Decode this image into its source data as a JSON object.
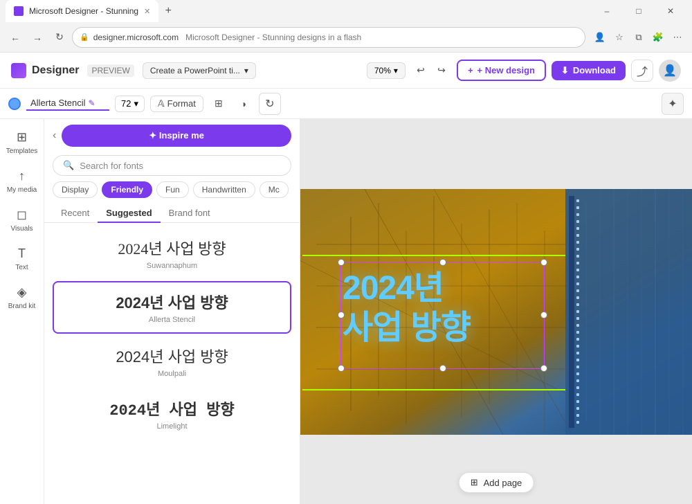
{
  "browser": {
    "tab_title": "Microsoft Designer - Stunning",
    "favicon_color": "#7c3aed",
    "url_domain": "designer.microsoft.com",
    "url_title": "Microsoft Designer - Stunning designs in a flash",
    "window_controls": [
      "minimize",
      "maximize",
      "close"
    ]
  },
  "app_header": {
    "logo_text": "Designer",
    "preview_label": "PREVIEW",
    "breadcrumb": "Create a PowerPoint ti...",
    "zoom": "70%",
    "new_design_label": "+ New design",
    "download_label": "Download"
  },
  "font_toolbar": {
    "font_name": "Allerta Stencil",
    "font_size": "72",
    "format_label": "Format"
  },
  "font_panel": {
    "inspire_label": "✦ Inspire me",
    "search_placeholder": "Search for fonts",
    "filters": [
      {
        "label": "Display",
        "active": false
      },
      {
        "label": "Friendly",
        "active": true
      },
      {
        "label": "Fun",
        "active": false
      },
      {
        "label": "Handwritten",
        "active": false
      },
      {
        "label": "Mc",
        "active": false
      }
    ],
    "tabs": [
      {
        "label": "Recent",
        "active": false
      },
      {
        "label": "Suggested",
        "active": true
      },
      {
        "label": "Brand font",
        "active": false
      }
    ],
    "fonts": [
      {
        "preview": "2024년 사업 방향",
        "name": "Suwannaphum",
        "selected": false,
        "style": "suwannaphum"
      },
      {
        "preview": "2024년 사업 방향",
        "name": "Allerta Stencil",
        "selected": true,
        "style": "allerta"
      },
      {
        "preview": "2024년 사업 방향",
        "name": "Moulpali",
        "selected": false,
        "style": "moulpali"
      },
      {
        "preview": "2024년 사업 방향",
        "name": "Limelight",
        "selected": false,
        "style": "limelight"
      }
    ]
  },
  "sidebar": {
    "items": [
      {
        "label": "Templates",
        "icon": "⊞"
      },
      {
        "label": "My media",
        "icon": "↑"
      },
      {
        "label": "Visuals",
        "icon": "◻"
      },
      {
        "label": "Text",
        "icon": "T"
      },
      {
        "label": "Brand kit",
        "icon": "◈"
      }
    ]
  },
  "canvas": {
    "text_line1": "2024년",
    "text_line2": "사업 방향"
  },
  "footer": {
    "add_page_label": "Add page"
  }
}
